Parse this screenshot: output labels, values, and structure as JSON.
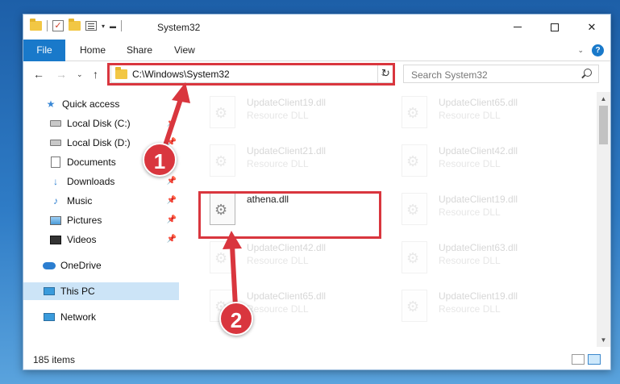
{
  "window": {
    "title": "System32"
  },
  "ribbon": {
    "tabs": [
      "File",
      "Home",
      "Share",
      "View"
    ]
  },
  "address": {
    "path": "C:\\Windows\\System32",
    "search_placeholder": "Search System32"
  },
  "nav": {
    "items": [
      {
        "label": "Quick access",
        "icon": "star-icon",
        "pinned": false
      },
      {
        "label": "Local Disk (C:)",
        "icon": "drive-icon",
        "pinned": true
      },
      {
        "label": "Local Disk (D:)",
        "icon": "drive-icon",
        "pinned": true
      },
      {
        "label": "Documents",
        "icon": "documents-icon",
        "pinned": true
      },
      {
        "label": "Downloads",
        "icon": "download-icon",
        "pinned": true
      },
      {
        "label": "Music",
        "icon": "music-icon",
        "pinned": true
      },
      {
        "label": "Pictures",
        "icon": "pictures-icon",
        "pinned": true
      },
      {
        "label": "Videos",
        "icon": "videos-icon",
        "pinned": true
      },
      {
        "label": "OneDrive",
        "icon": "cloud-icon",
        "pinned": false
      },
      {
        "label": "This PC",
        "icon": "pc-icon",
        "pinned": false,
        "selected": true
      },
      {
        "label": "Network",
        "icon": "network-icon",
        "pinned": false
      }
    ]
  },
  "files": [
    {
      "name": "UpdateClient19.dll",
      "type": "Resource DLL",
      "faded": true
    },
    {
      "name": "UpdateClient65.dll",
      "type": "Resource DLL",
      "faded": true
    },
    {
      "name": "UpdateClient21.dll",
      "type": "Resource DLL",
      "faded": true
    },
    {
      "name": "UpdateClient42.dll",
      "type": "Resource DLL",
      "faded": true
    },
    {
      "name": "athena.dll",
      "type": "",
      "faded": false
    },
    {
      "name": "UpdateClient19.dll",
      "type": "Resource DLL",
      "faded": true
    },
    {
      "name": "UpdateClient42.dll",
      "type": "Resource DLL",
      "faded": true
    },
    {
      "name": "UpdateClient63.dll",
      "type": "Resource DLL",
      "faded": true
    },
    {
      "name": "UpdateClient65.dll",
      "type": "Resource DLL",
      "faded": true
    },
    {
      "name": "UpdateClient19.dll",
      "type": "Resource DLL",
      "faded": true
    }
  ],
  "status": {
    "items_count": "185 items"
  },
  "callouts": {
    "one": "1",
    "two": "2"
  },
  "colors": {
    "accent": "#1979ca",
    "highlight": "#d9363e"
  }
}
